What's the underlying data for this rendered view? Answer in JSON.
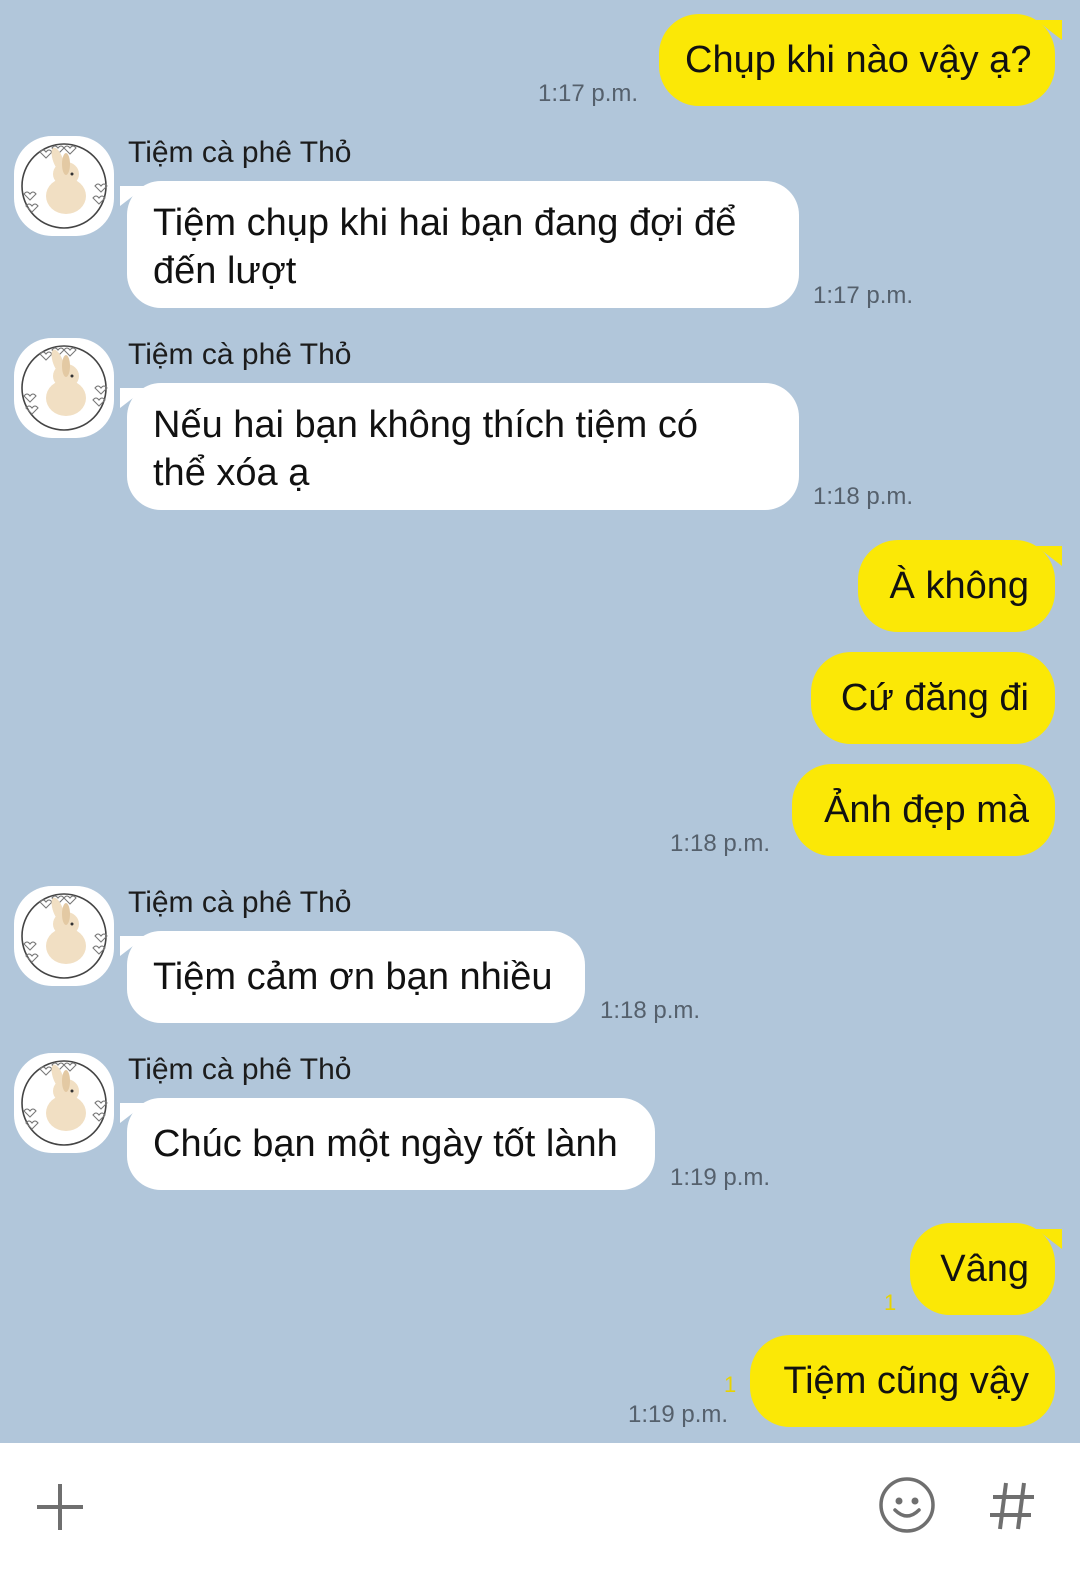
{
  "contact": {
    "name": "Tiệm cà phê Thỏ",
    "avatar_icon": "rabbit-avatar-icon"
  },
  "colors": {
    "background": "#b1c6da",
    "outgoing_bubble": "#fbe806",
    "incoming_bubble": "#ffffff"
  },
  "messages": [
    {
      "from": "me",
      "text": "Chụp khi nào vậy ạ?",
      "time": "1:17 p.m."
    },
    {
      "from": "them",
      "sender": "Tiệm cà phê Thỏ",
      "line1": "Tiệm chụp khi hai bạn đang đợi để",
      "line2": "đến lượt",
      "time": "1:17 p.m."
    },
    {
      "from": "them",
      "sender": "Tiệm cà phê Thỏ",
      "line1": "Nếu hai bạn không thích tiệm có",
      "line2": "thể xóa ạ",
      "time": "1:18 p.m."
    },
    {
      "from": "me",
      "text": "À không"
    },
    {
      "from": "me",
      "text": "Cứ đăng đi"
    },
    {
      "from": "me",
      "text": "Ảnh đẹp mà",
      "time": "1:18 p.m."
    },
    {
      "from": "them",
      "sender": "Tiệm cà phê Thỏ",
      "text": "Tiệm cảm ơn bạn nhiều",
      "time": "1:18 p.m."
    },
    {
      "from": "them",
      "sender": "Tiệm cà phê Thỏ",
      "text": "Chúc bạn một ngày tốt lành",
      "time": "1:19 p.m."
    },
    {
      "from": "me",
      "text": "Vâng",
      "unread": "1"
    },
    {
      "from": "me",
      "text": "Tiệm cũng vậy",
      "unread": "1",
      "time": "1:19 p.m."
    }
  ],
  "composer": {
    "add_icon": "plus-icon",
    "emoji_icon": "emoji-icon",
    "hashtag_icon": "hashtag-icon"
  }
}
